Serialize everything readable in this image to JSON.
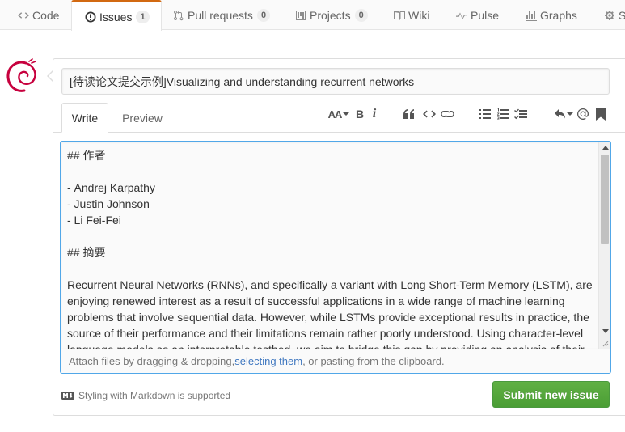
{
  "nav": {
    "tabs": [
      {
        "label": "Code",
        "icon": "code-icon"
      },
      {
        "label": "Issues",
        "icon": "issue-opened-icon",
        "count": "1",
        "selected": true
      },
      {
        "label": "Pull requests",
        "icon": "git-pull-request-icon",
        "count": "0"
      },
      {
        "label": "Projects",
        "icon": "project-icon",
        "count": "0"
      },
      {
        "label": "Wiki",
        "icon": "book-icon"
      },
      {
        "label": "Pulse",
        "icon": "pulse-icon"
      },
      {
        "label": "Graphs",
        "icon": "graph-icon"
      },
      {
        "label": "S",
        "icon": "gear-icon"
      }
    ]
  },
  "form": {
    "title_value": "[待读论文提交示例]Visualizing and understanding recurrent networks",
    "write_tab": "Write",
    "preview_tab": "Preview",
    "toolbar": {
      "header_label": "AA",
      "bold_label": "B",
      "italic_label": "i"
    },
    "body_text": "## 作者\n\n- Andrej Karpathy\n- Justin Johnson\n- Li Fei-Fei\n\n## 摘要\n\nRecurrent Neural Networks (RNNs), and specifically a variant with Long Short-Term Memory (LSTM), are enjoying renewed interest as a result of successful applications in a wide range of machine learning problems that involve sequential data. However, while LSTMs provide exceptional results in practice, the source of their performance and their limitations remain rather poorly understood. Using character-level language models as an interpretable testbed, we aim to bridge this gap by providing an analysis of their",
    "attach": {
      "prefix": "Attach files by dragging & dropping, ",
      "link": "selecting them",
      "suffix": ", or pasting from the clipboard."
    },
    "markdown_note": "Styling with Markdown is supported",
    "submit_label": "Submit new issue"
  },
  "colors": {
    "accent_tab": "#d26911",
    "link": "#4078c0",
    "submit_green": "#5aa93f",
    "focus_border": "#51a7e8",
    "avatar_red": "#c7013e"
  }
}
